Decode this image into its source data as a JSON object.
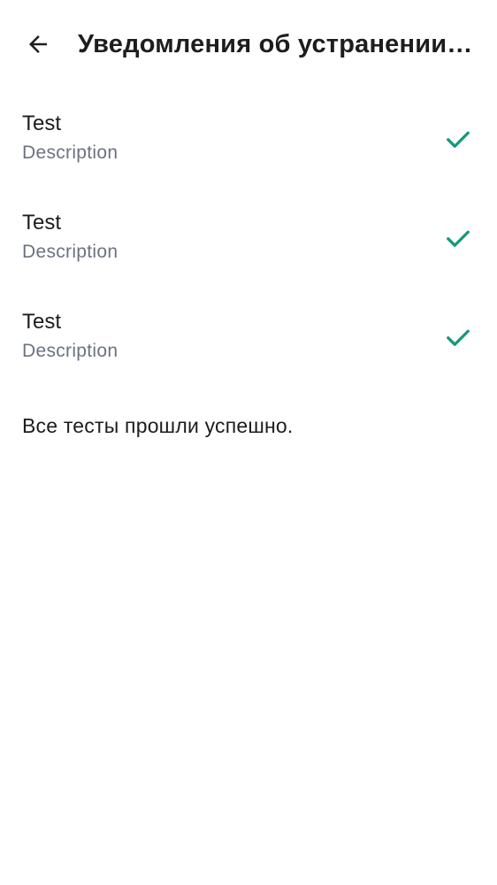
{
  "header": {
    "back_icon": "arrow-back-icon",
    "title": "Уведомления об устранении …"
  },
  "tests": [
    {
      "title": "Test",
      "description": "Description",
      "status_icon": "check-icon",
      "status_color": "#14997a"
    },
    {
      "title": "Test",
      "description": "Description",
      "status_icon": "check-icon",
      "status_color": "#14997a"
    },
    {
      "title": "Test",
      "description": "Description",
      "status_icon": "check-icon",
      "status_color": "#14997a"
    }
  ],
  "summary": "Все тесты прошли успешно."
}
